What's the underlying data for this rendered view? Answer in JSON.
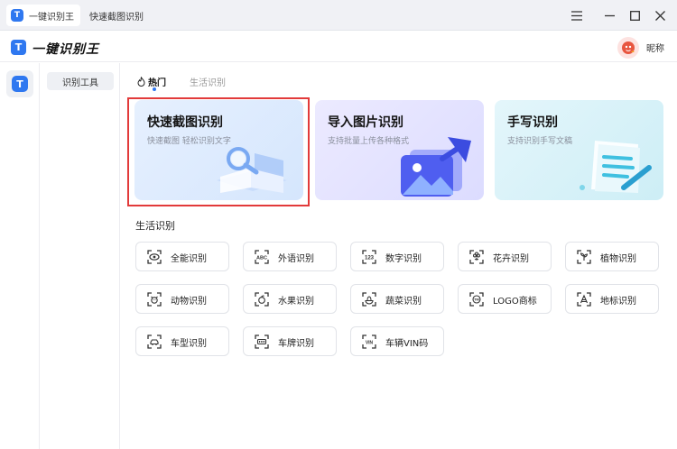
{
  "window": {
    "tabs": [
      {
        "label": "一键识别王",
        "active": true
      },
      {
        "label": "快速截图识别",
        "active": false
      }
    ],
    "logo_glyph": "T"
  },
  "app": {
    "title": "一键识别王",
    "user_nickname": "昵称"
  },
  "sidebar": {
    "items": [
      {
        "label": "识别工具",
        "selected": true
      }
    ]
  },
  "main": {
    "tabs": [
      {
        "label": "热门",
        "active": true
      },
      {
        "label": "生活识别",
        "active": false
      }
    ],
    "cards": [
      {
        "title": "快速截图识别",
        "subtitle": "快速截图 轻松识别文字",
        "highlighted": true
      },
      {
        "title": "导入图片识别",
        "subtitle": "支持批量上传各种格式"
      },
      {
        "title": "手写识别",
        "subtitle": "支持识别手写文稿"
      }
    ],
    "section_title": "生活识别",
    "features": [
      {
        "label": "全能识别",
        "icon": "eye-scan-icon"
      },
      {
        "label": "外语识别",
        "icon": "abc-scan-icon"
      },
      {
        "label": "数字识别",
        "icon": "123-scan-icon"
      },
      {
        "label": "花卉识别",
        "icon": "flower-scan-icon"
      },
      {
        "label": "植物识别",
        "icon": "plant-scan-icon"
      },
      {
        "label": "动物识别",
        "icon": "animal-scan-icon"
      },
      {
        "label": "水果识别",
        "icon": "fruit-scan-icon"
      },
      {
        "label": "蔬菜识别",
        "icon": "vegetable-scan-icon"
      },
      {
        "label": "LOGO商标",
        "icon": "logo-scan-icon"
      },
      {
        "label": "地标识别",
        "icon": "landmark-scan-icon"
      },
      {
        "label": "车型识别",
        "icon": "car-scan-icon"
      },
      {
        "label": "车牌识别",
        "icon": "plate-scan-icon"
      },
      {
        "label": "车辆VIN码",
        "icon": "vin-scan-icon"
      }
    ],
    "feature_icon_texts": {
      "abc": "ABC",
      "num": "123",
      "logo": "TM",
      "vin": "VIN"
    }
  },
  "colors": {
    "accent": "#2f78f0",
    "highlight_border": "#e23a3a"
  }
}
